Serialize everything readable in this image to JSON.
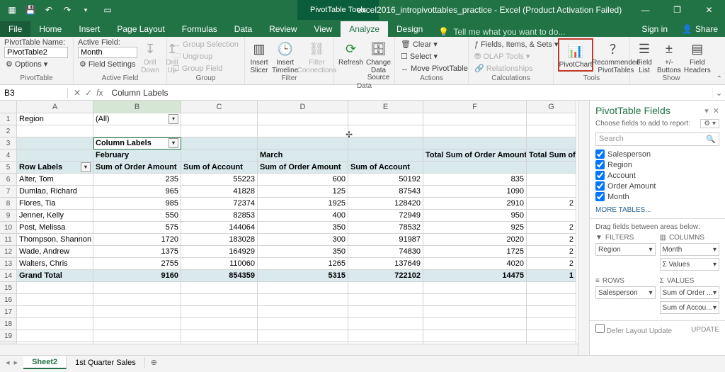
{
  "titlebar": {
    "context_tools": "PivotTable Tools",
    "title": "excel2016_intropivottables_practice - Excel (Product Activation Failed)"
  },
  "tabs": {
    "file": "File",
    "home": "Home",
    "insert": "Insert",
    "pagelayout": "Page Layout",
    "formulas": "Formulas",
    "data": "Data",
    "review": "Review",
    "view": "View",
    "analyze": "Analyze",
    "design": "Design",
    "tellme": "Tell me what you want to do...",
    "signin": "Sign in",
    "share": "Share"
  },
  "ribbon": {
    "pt_name_label": "PivotTable Name:",
    "pt_name_value": "PivotTable2",
    "options": "Options",
    "group_pt": "PivotTable",
    "af_label": "Active Field:",
    "af_value": "Month",
    "field_settings": "Field Settings",
    "drill_down": "Drill Down",
    "drill_up": "Drill Up",
    "group_af": "Active Field",
    "grp_sel": "Group Selection",
    "grp_un": "Ungroup",
    "grp_field": "Group Field",
    "group_grp": "Group",
    "ins_slicer": "Insert Slicer",
    "ins_timeline": "Insert Timeline",
    "filter_conn": "Filter Connections",
    "group_filter": "Filter",
    "refresh": "Refresh",
    "change_ds": "Change Data Source",
    "group_data": "Data",
    "clear": "Clear",
    "select": "Select",
    "move_pt": "Move PivotTable",
    "group_actions": "Actions",
    "fis": "Fields, Items, & Sets",
    "olap": "OLAP Tools",
    "rel": "Relationships",
    "group_calc": "Calculations",
    "pivotchart": "PivotChart",
    "rec_pt": "Recommended PivotTables",
    "group_tools": "Tools",
    "field_list": "Field List",
    "pm_buttons": "+/- Buttons",
    "field_headers": "Field Headers",
    "group_show": "Show"
  },
  "fx": {
    "namebox": "B3",
    "content": "Column Labels"
  },
  "columns": [
    "A",
    "B",
    "C",
    "D",
    "E",
    "F",
    "G"
  ],
  "grid": {
    "r1": {
      "A": "Region",
      "B": "(All)"
    },
    "r3": {
      "B": "Column Labels"
    },
    "r4": {
      "B": "February",
      "D": "March",
      "F": "Total Sum of Order Amount",
      "G": "Total Sum of Ac"
    },
    "r5": {
      "A": "Row Labels",
      "B": "Sum of Order Amount",
      "C": "Sum of Account",
      "D": "Sum of Order Amount",
      "E": "Sum of Account"
    },
    "r14": {
      "A": "Grand Total",
      "B": "9160",
      "C": "854359",
      "D": "5315",
      "E": "722102",
      "F": "14475",
      "G": "1"
    }
  },
  "data_rows": [
    {
      "name": "Alter, Tom",
      "b": "235",
      "c": "55223",
      "d": "600",
      "e": "50192",
      "f": "835",
      "g": ""
    },
    {
      "name": "Dumlao, Richard",
      "b": "965",
      "c": "41828",
      "d": "125",
      "e": "87543",
      "f": "1090",
      "g": ""
    },
    {
      "name": "Flores, Tia",
      "b": "985",
      "c": "72374",
      "d": "1925",
      "e": "128420",
      "f": "2910",
      "g": "2"
    },
    {
      "name": "Jenner, Kelly",
      "b": "550",
      "c": "82853",
      "d": "400",
      "e": "72949",
      "f": "950",
      "g": ""
    },
    {
      "name": "Post, Melissa",
      "b": "575",
      "c": "144064",
      "d": "350",
      "e": "78532",
      "f": "925",
      "g": "2"
    },
    {
      "name": "Thompson, Shannon",
      "b": "1720",
      "c": "183028",
      "d": "300",
      "e": "91987",
      "f": "2020",
      "g": "2"
    },
    {
      "name": "Wade, Andrew",
      "b": "1375",
      "c": "164929",
      "d": "350",
      "e": "74830",
      "f": "1725",
      "g": "2"
    },
    {
      "name": "Walters, Chris",
      "b": "2755",
      "c": "110060",
      "d": "1265",
      "e": "137649",
      "f": "4020",
      "g": "2"
    }
  ],
  "fieldpane": {
    "title": "PivotTable Fields",
    "choose": "Choose fields to add to report:",
    "search_ph": "Search",
    "fields": [
      "Salesperson",
      "Region",
      "Account",
      "Order Amount",
      "Month"
    ],
    "more": "MORE TABLES...",
    "drag": "Drag fields between areas below:",
    "area_filters": "FILTERS",
    "area_columns": "COLUMNS",
    "area_rows": "ROWS",
    "area_values": "VALUES",
    "filter_item": "Region",
    "col_item1": "Month",
    "col_item2": "Σ  Values",
    "row_item": "Salesperson",
    "val_item1": "Sum of Order ...",
    "val_item2": "Sum of Accou...",
    "defer": "Defer Layout Update",
    "update": "UPDATE"
  },
  "sheets": {
    "active": "Sheet2",
    "other": "1st Quarter Sales"
  }
}
